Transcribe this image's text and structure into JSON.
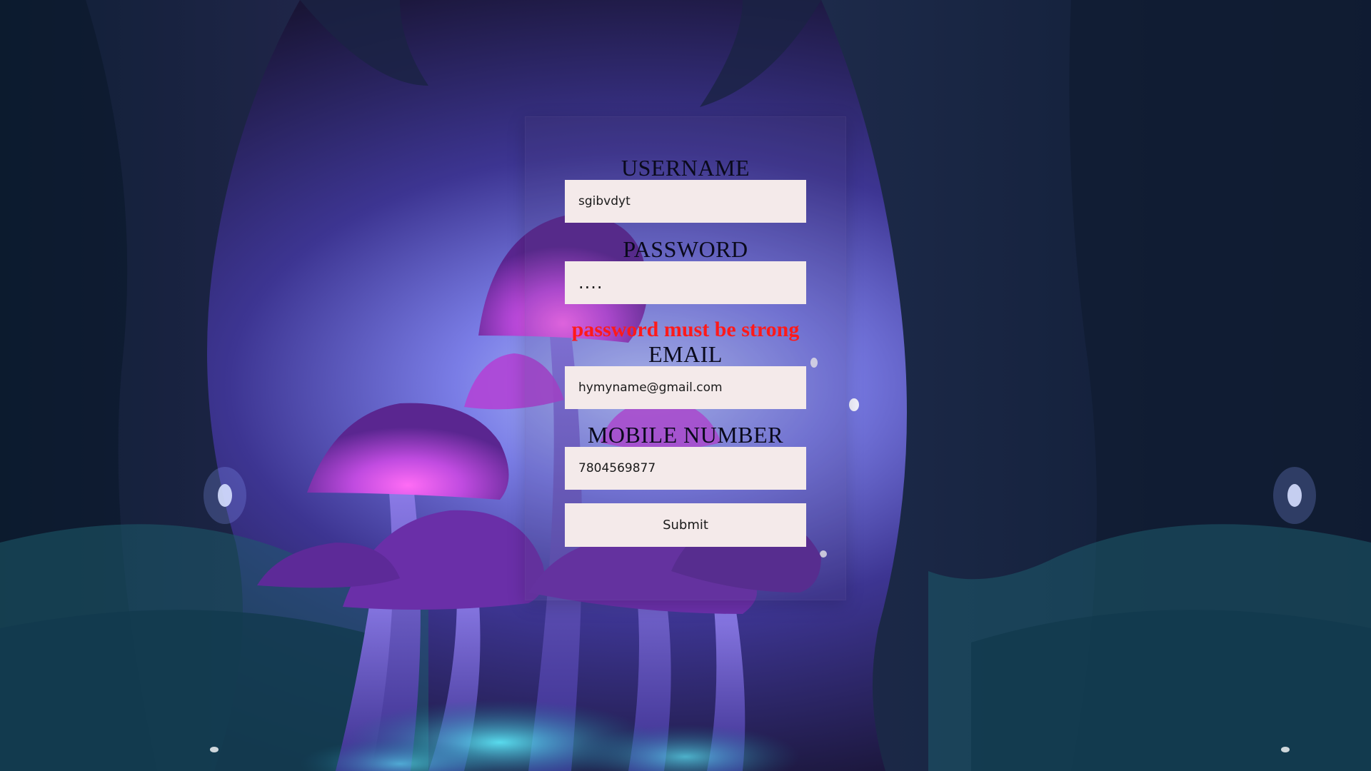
{
  "form": {
    "username": {
      "label": "USERNAME",
      "value": "sgibvdyt"
    },
    "password": {
      "label": "PASSWORD",
      "value": "....",
      "error": "password must be strong"
    },
    "email": {
      "label": "EMAIL",
      "value": "hymyname@gmail.com"
    },
    "mobile": {
      "label": "MOBILE NUMBER",
      "value": "7804569877"
    },
    "submit_label": "Submit"
  },
  "colors": {
    "input_background": "#f4eaea",
    "error_text": "#ff1a1a",
    "label_text": "#0a0a1c"
  }
}
